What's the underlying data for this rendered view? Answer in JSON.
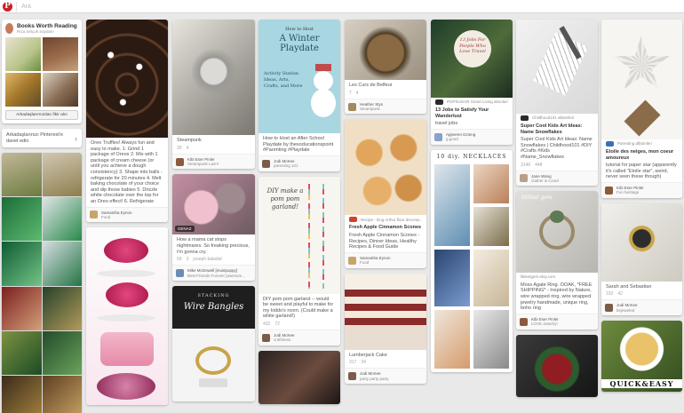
{
  "header": {
    "logo": "P",
    "search_placeholder": "Ara"
  },
  "board": {
    "title": "Books Worth Reading",
    "owner": "Rıza Selçuk Saydam",
    "button": "Arkadaşlarımızdan fikir alın"
  },
  "invite": {
    "label": "Arkadaşlarınızı Pinterest'e davet edin",
    "arrow": "›"
  },
  "pins": {
    "p1": {
      "desc": "Oreo Truffles! Always fun and easy to make. 1. Grind 1 package of Oreos 2. Mix with 1 package of cream cheese (or until you achieve a dough consistency) 3. Shape into balls - refrigerate for 20 minutes 4. Melt baking chocolate of your choice and dip those babies 5. Drizzle white chocolate over the top for an Oreo effect! 6. Refrigerate",
      "user": "Samantha Eynon",
      "board": "Food"
    },
    "p2": {
      "desc": "Steampunk",
      "stats": [
        "30",
        "4"
      ],
      "user": "Kibi Eser Pinler",
      "board": "Steampunk Las!!!"
    },
    "p3": {
      "desc": "How a mama cat stops nightmares. So freaking precious, i'm gonna cry.",
      "stats": [
        "69",
        "3"
      ],
      "extra": "joseph baladal",
      "badge": "GENAZ",
      "user": "Mike McDowell [mustpuppy]",
      "board": "Best Friends Forever [awesom..."
    },
    "p4": {
      "banner": "stacking",
      "title": "Wire Bangles"
    },
    "p5": {
      "img_top": "How to Host",
      "img_title": "A Winter Playdate",
      "img_sub": "Activity Station Ideas, Arts, Crafts, and More",
      "desc": "How to Host an After School Playdate by thesoducationspoint #Parenting #Playdate",
      "user": "Jodi McKee",
      "board": "parenting 101"
    },
    "p6": {
      "img": "DIY make a pom pom garland!",
      "desc": "DIY pom pom garland -- would be sweet and playful to make for my kiddo's room. (Could make a white garland!)",
      "stats": [
        "432",
        "72"
      ],
      "user": "Jodi McKee",
      "board": "craftiness"
    },
    "p7": {
      "desc": "Les Curs de Belfeur",
      "stats": [
        "7",
        "4"
      ],
      "user": "Heather Stys",
      "board": "Steampunk"
    },
    "p8": {
      "desc": "Fresh Apple Cinnamon Scones",
      "extra": "Fresh Apple Cinnamon Scones - Recipes, Dinner Ideas, Healthy Recipes & Food Guide",
      "source": "Recipe - king Arthur flour decorat...",
      "user": "Samantha Eynon",
      "board": "Food"
    },
    "p9": {
      "desc": "Lumberjack Cake",
      "stats": [
        "317",
        "34"
      ],
      "user": "Jodi McKee",
      "board": "party party party"
    },
    "p10": {
      "img": "13 Jobs For People Who Love Travel",
      "source": "POPSUGAR Smart Living absolum",
      "desc": "13 Jobs to Satisfy Your Wanderlust",
      "extra": "travel jobs",
      "user": "Apjeeren Dzieng",
      "board": "g.good",
      "banner": "10 diy. NECKLACES"
    },
    "p11": {
      "source": "Childhood101 albümleri",
      "desc": "Super Cool Kids Art Ideas: Name Snowflakes",
      "extra": "Super Cool Kids Art Ideas: Name Snowflakes | Childhood101 #DIY #Crafts #Kids #Name_Snowflakes",
      "stats": [
        "3146",
        "448"
      ],
      "user": "Jane Wang",
      "board": "Gather & Crowl"
    },
    "p12": {
      "img": "littlest gem",
      "source": "littlestgem.etsy.com",
      "desc": "Moss Agate Ring. OOAK, *FREE SHIPPING* - Inspired by Nature, wire wrapped ring, wire wrapped jewelry handmade, unique ring, boho ring",
      "user": "Kibi Eser Pinler",
      "board": "LOVE Jewelry!"
    },
    "p13": {
      "source": "Parenting albümleri",
      "desc": "Etoile des neiges, mon coeur amoureux",
      "extra": "tutorial for paper star (apparently it's called \"Etoile star\", weird, never seen these though)",
      "user": "Kibi Eser Pinler",
      "board": "Fun heritage"
    },
    "p14": {
      "desc": "Sarah and Sebastian",
      "stats": [
        "192",
        "42"
      ],
      "user": "Jodi McKee",
      "board": "bejeweled"
    },
    "p15": {
      "img": "QUICK&EASY"
    }
  }
}
